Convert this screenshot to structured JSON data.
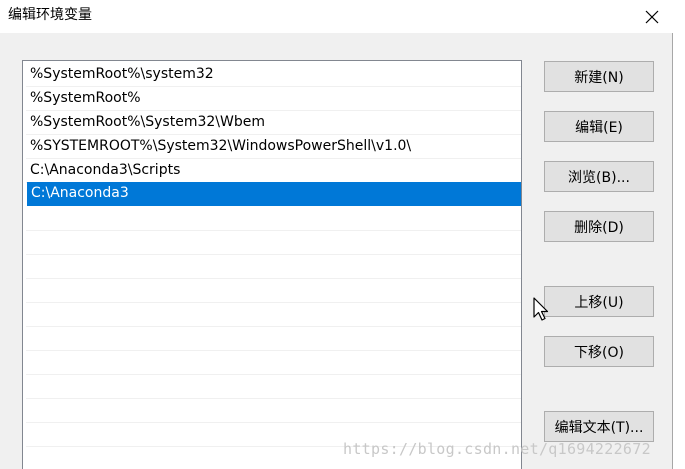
{
  "window": {
    "title": "编辑环境变量",
    "close_icon": "close-icon"
  },
  "list": {
    "items": [
      {
        "label": "%SystemRoot%\\system32",
        "selected": false
      },
      {
        "label": "%SystemRoot%",
        "selected": false
      },
      {
        "label": "%SystemRoot%\\System32\\Wbem",
        "selected": false
      },
      {
        "label": "%SYSTEMROOT%\\System32\\WindowsPowerShell\\v1.0\\",
        "selected": false
      },
      {
        "label": "C:\\Anaconda3\\Scripts",
        "selected": false
      },
      {
        "label": "C:\\Anaconda3",
        "selected": true
      }
    ],
    "selection_color": "#0078d7"
  },
  "buttons": {
    "new": "新建(N)",
    "edit": "编辑(E)",
    "browse": "浏览(B)...",
    "delete": "删除(D)",
    "move_up": "上移(U)",
    "move_down": "下移(O)",
    "edit_text": "编辑文本(T)..."
  },
  "watermark": "https://blog.csdn.net/q1694222672",
  "colors": {
    "accent": "#0078d7",
    "button_bg": "#e1e1e1",
    "button_border": "#adadad",
    "dialog_bg": "#f0f0f0"
  }
}
